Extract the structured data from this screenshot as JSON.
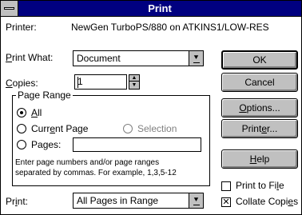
{
  "window": {
    "title": "Print"
  },
  "printer": {
    "label": "Printer:",
    "value": "NewGen TurboPS/880 on ATKINS1/LOW-RES"
  },
  "print_what": {
    "label_u": "P",
    "label_rest": "rint What:",
    "value": "Document",
    "arrow": "⯆"
  },
  "copies": {
    "label_u": "C",
    "label_rest": "opies:",
    "value": "1",
    "up": "▲",
    "down": "▼"
  },
  "page_range": {
    "legend": "Page Range",
    "all_u": "A",
    "all_rest": "ll",
    "current_pre": "Curr",
    "current_u": "e",
    "current_rest": "nt Page",
    "selection": "Selection",
    "pages_pre": "Pa",
    "pages_u": "g",
    "pages_rest": "es:",
    "hint_line1": "Enter page numbers and/or page ranges",
    "hint_line2": "separated by commas.  For example, 1,3,5-12"
  },
  "print": {
    "label_pre": "Pr",
    "label_u": "i",
    "label_rest": "nt:",
    "value": "All Pages in Range",
    "arrow": "⯆"
  },
  "buttons": {
    "ok": "OK",
    "cancel": "Cancel",
    "options_u": "O",
    "options_rest": "ptions...",
    "printer_pre": "Print",
    "printer_u": "e",
    "printer_rest": "r...",
    "help_u": "H",
    "help_rest": "elp"
  },
  "checkboxes": {
    "print_to_file_pre": "Print to Fi",
    "print_to_file_u": "l",
    "print_to_file_rest": "e",
    "print_to_file_checked": false,
    "collate_pre": "Collate Copi",
    "collate_u": "e",
    "collate_rest": "s",
    "collate_checked": true,
    "check_mark": "✕"
  }
}
